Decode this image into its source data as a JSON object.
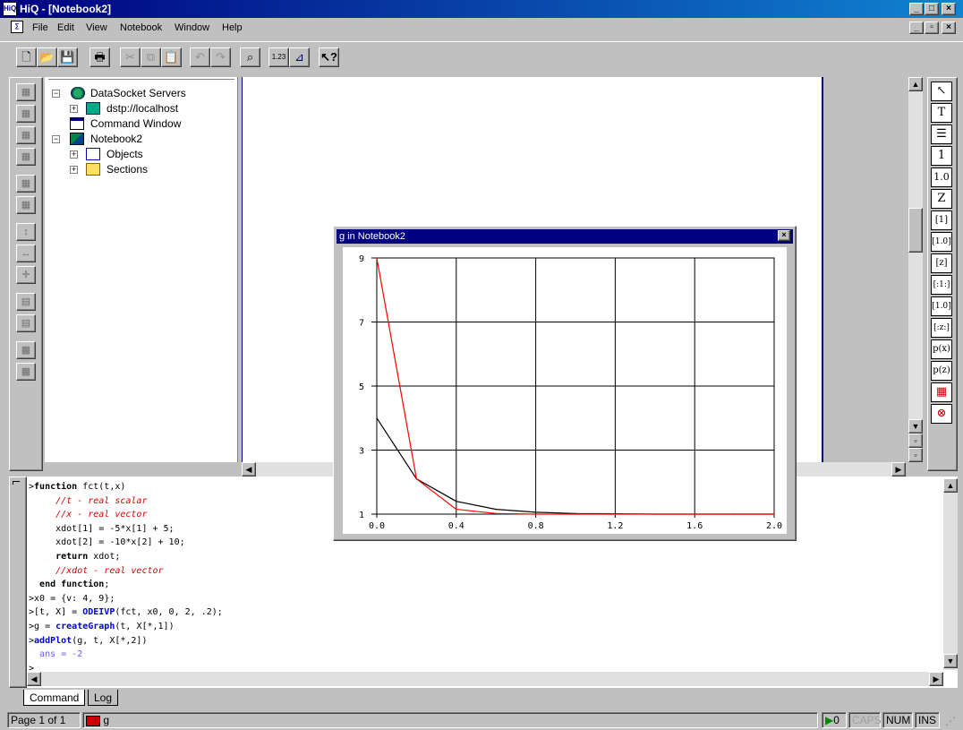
{
  "window": {
    "title": "HiQ - [Notebook2]",
    "app_icon": "HiQ"
  },
  "menu": [
    "File",
    "Edit",
    "View",
    "Notebook",
    "Window",
    "Help"
  ],
  "tree": {
    "items": [
      {
        "label": "DataSocket Servers",
        "icon": "datasocket-icon"
      },
      {
        "label": "dstp://localhost",
        "icon": "server-icon"
      },
      {
        "label": "Command Window",
        "icon": "command-window-icon"
      },
      {
        "label": "Notebook2",
        "icon": "notebook-icon"
      },
      {
        "label": "Objects",
        "icon": "objects-icon"
      },
      {
        "label": "Sections",
        "icon": "folder-icon"
      }
    ]
  },
  "right_toolbar": [
    "↖",
    "T",
    "☰",
    "1",
    "1.0",
    "Z",
    "[1]",
    "[1.0]",
    "[z]",
    "[:1:]",
    "[1.0]",
    "[:z:]",
    "p(x)",
    "p(z)",
    "▦",
    "⊗"
  ],
  "graph": {
    "title": "g in Notebook2"
  },
  "chart_data": {
    "type": "line",
    "xlim": [
      0,
      2
    ],
    "ylim": [
      1,
      9
    ],
    "x_ticks": [
      "0.0",
      "0.4",
      "0.8",
      "1.2",
      "1.6",
      "2.0"
    ],
    "y_ticks": [
      "1",
      "3",
      "5",
      "7",
      "9"
    ],
    "grid": true,
    "series": [
      {
        "color": "#000000",
        "x": [
          0,
          0.2,
          0.4,
          0.6,
          0.8,
          1.0,
          1.2,
          1.4,
          1.6,
          1.8,
          2.0
        ],
        "y": [
          4,
          2.1,
          1.4,
          1.15,
          1.06,
          1.02,
          1.01,
          1.0,
          1.0,
          1.0,
          1.0
        ]
      },
      {
        "color": "#ff0000",
        "x": [
          0,
          0.2,
          0.4,
          0.6,
          0.8,
          1.0,
          1.2,
          1.4,
          1.6,
          1.8,
          2.0
        ],
        "y": [
          9,
          2.1,
          1.15,
          1.02,
          1.0,
          1.0,
          1.0,
          1.0,
          1.0,
          1.0,
          1.0
        ]
      }
    ]
  },
  "command": {
    "lines": [
      {
        "prompt": ">",
        "parts": [
          {
            "t": "function",
            "c": "kw"
          },
          {
            "t": " fct(t,x)",
            "c": ""
          }
        ]
      },
      {
        "prompt": "",
        "parts": [
          {
            "t": "    //t - real scalar",
            "c": "cm"
          }
        ]
      },
      {
        "prompt": "",
        "parts": [
          {
            "t": "    //x - real vector",
            "c": "cm"
          }
        ]
      },
      {
        "prompt": "",
        "parts": [
          {
            "t": "    xdot[1] = -5*x[1] + 5;",
            "c": ""
          }
        ]
      },
      {
        "prompt": "",
        "parts": [
          {
            "t": "    xdot[2] = -10*x[2] + 10;",
            "c": ""
          }
        ]
      },
      {
        "prompt": "",
        "parts": [
          {
            "t": "    ",
            "c": ""
          },
          {
            "t": "return",
            "c": "kw"
          },
          {
            "t": " xdot;",
            "c": ""
          }
        ]
      },
      {
        "prompt": "",
        "parts": [
          {
            "t": "    //xdot - real vector",
            "c": "cm"
          }
        ]
      },
      {
        "prompt": "",
        "parts": [
          {
            "t": " end function",
            "c": "kw"
          },
          {
            "t": ";",
            "c": ""
          }
        ]
      },
      {
        "prompt": ">",
        "parts": [
          {
            "t": "x0 = {v: 4, 9};",
            "c": ""
          }
        ]
      },
      {
        "prompt": ">",
        "parts": [
          {
            "t": "[t, X] = ",
            "c": ""
          },
          {
            "t": "ODEIVP",
            "c": "fn"
          },
          {
            "t": "(fct, x0, 0, 2, .2);",
            "c": ""
          }
        ]
      },
      {
        "prompt": ">",
        "parts": [
          {
            "t": "g = ",
            "c": ""
          },
          {
            "t": "createGraph",
            "c": "fn"
          },
          {
            "t": "(t, X[*,1])",
            "c": ""
          }
        ]
      },
      {
        "prompt": ">",
        "parts": [
          {
            "t": "addPlot",
            "c": "fn"
          },
          {
            "t": "(g, t, X[*,2])",
            "c": ""
          }
        ]
      },
      {
        "prompt": "",
        "parts": [
          {
            "t": " ans = -2",
            "c": "ans"
          }
        ]
      },
      {
        "prompt": ">",
        "parts": []
      }
    ]
  },
  "tabs": [
    "Command",
    "Log"
  ],
  "status": {
    "page": "Page 1 of 1",
    "graph": "g",
    "count": "0",
    "caps": "CAPS",
    "num": "NUM",
    "ins": "INS"
  }
}
